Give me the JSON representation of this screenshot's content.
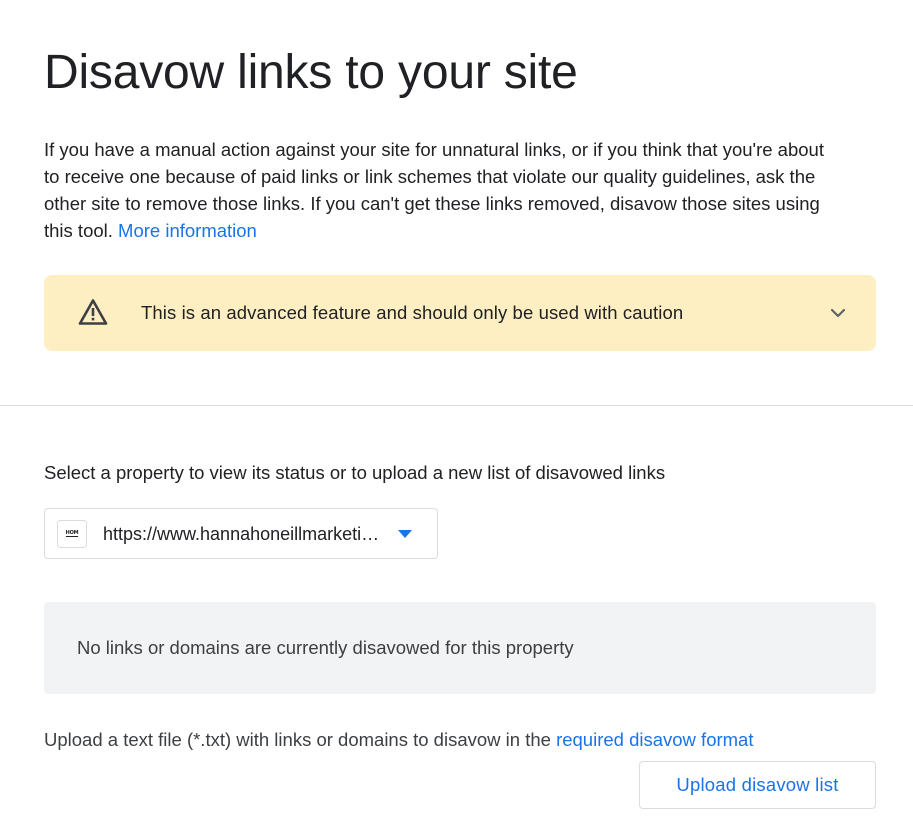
{
  "page": {
    "title": "Disavow links to your site"
  },
  "intro": {
    "text": "If you have a manual action against your site for unnatural links, or if you think that you're about to receive one because of paid links or link schemes that violate our quality guidelines, ask the other site to remove those links. If you can't get these links removed, disavow those sites using this tool.",
    "link_text": "More information"
  },
  "warning": {
    "icon": "warning-triangle-icon",
    "text": "This is an advanced feature and should only be used with caution",
    "expand_icon": "chevron-down-icon"
  },
  "property_selector": {
    "label": "Select a property to view its status or to upload a new list of disavowed links",
    "selected_value": "https://www.hannahoneillmarketing.com/",
    "favicon_text": "HOM",
    "dropdown_icon": "triangle-down-icon"
  },
  "status": {
    "text": "No links or domains are currently disavowed for this property"
  },
  "upload": {
    "instructions": "Upload a text file (*.txt) with links or domains to disavow in the",
    "format_link_text": "required disavow format",
    "button_label": "Upload disavow list"
  },
  "colors": {
    "link": "#1a73e8",
    "warning_bg": "#feefc3",
    "status_bg": "#f1f3f4",
    "text": "#202124",
    "border": "#dadce0"
  }
}
